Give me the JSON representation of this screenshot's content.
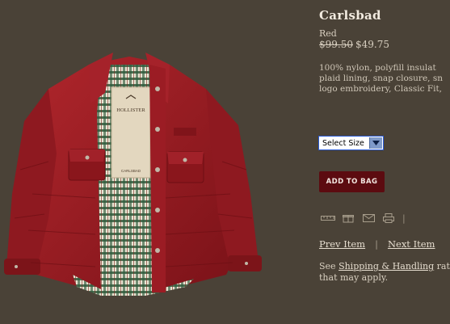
{
  "product": {
    "name": "Carlsbad",
    "color": "Red",
    "price_original": "$99.50",
    "price_sale": "$49.75",
    "description_lines": [
      "100% nylon, polyfill insulat",
      "plaid lining, snap closure, sn",
      "logo embroidery, Classic Fit,"
    ],
    "label_brand": "HOLLISTER",
    "label_sub": "CARLSBAD"
  },
  "size_select": {
    "selected": "Select Size"
  },
  "add_to_bag_label": "ADD TO BAG",
  "tool_icons": [
    "ruler-icon",
    "gift-icon",
    "email-icon",
    "print-icon"
  ],
  "nav": {
    "prev": "Prev Item",
    "next": "Next Item",
    "separator": "|"
  },
  "shipping": {
    "prefix": "See ",
    "link": "Shipping & Handling",
    "suffix": " rat",
    "line2": "that may apply."
  },
  "colors": {
    "background": "#4a4237",
    "jacket": "#9b1c24",
    "button": "#5c0b10"
  }
}
